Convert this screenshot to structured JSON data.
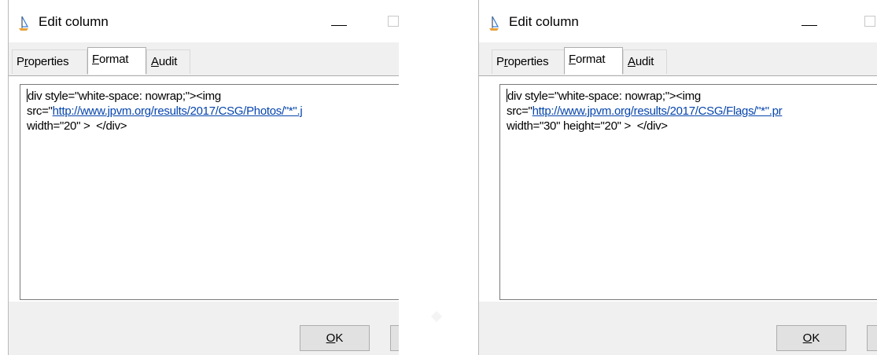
{
  "dialogs": [
    {
      "title": "Edit column",
      "tabs": [
        {
          "pre": "P",
          "acc": "r",
          "post": "operties"
        },
        {
          "pre": "",
          "acc": "F",
          "post": "ormat"
        },
        {
          "pre": "",
          "acc": "A",
          "post": "udit"
        }
      ],
      "active_tab": "Format",
      "code": {
        "line1": "div style=\"white-space: nowrap;\"><img",
        "line2_prefix": "src=\"",
        "line2_link": "http://www.jpvm.org/results/2017/CSG/Photos/\"*\".j",
        "line3": "width=\"20\" >  </div>"
      },
      "ok_button": {
        "acc": "O",
        "post": "K"
      }
    },
    {
      "title": "Edit column",
      "tabs": [
        {
          "pre": "P",
          "acc": "r",
          "post": "operties"
        },
        {
          "pre": "",
          "acc": "F",
          "post": "ormat"
        },
        {
          "pre": "",
          "acc": "A",
          "post": "udit"
        }
      ],
      "active_tab": "Format",
      "code": {
        "line1": "div style=\"white-space: nowrap;\"><img",
        "line2_prefix": "src=\"",
        "line2_link": "http://www.jpvm.org/results/2017/CSG/Flags/\"*\".pr",
        "line3": "width=\"30\" height=\"20\" >  </div>"
      },
      "ok_button": {
        "acc": "O",
        "post": "K"
      }
    }
  ]
}
